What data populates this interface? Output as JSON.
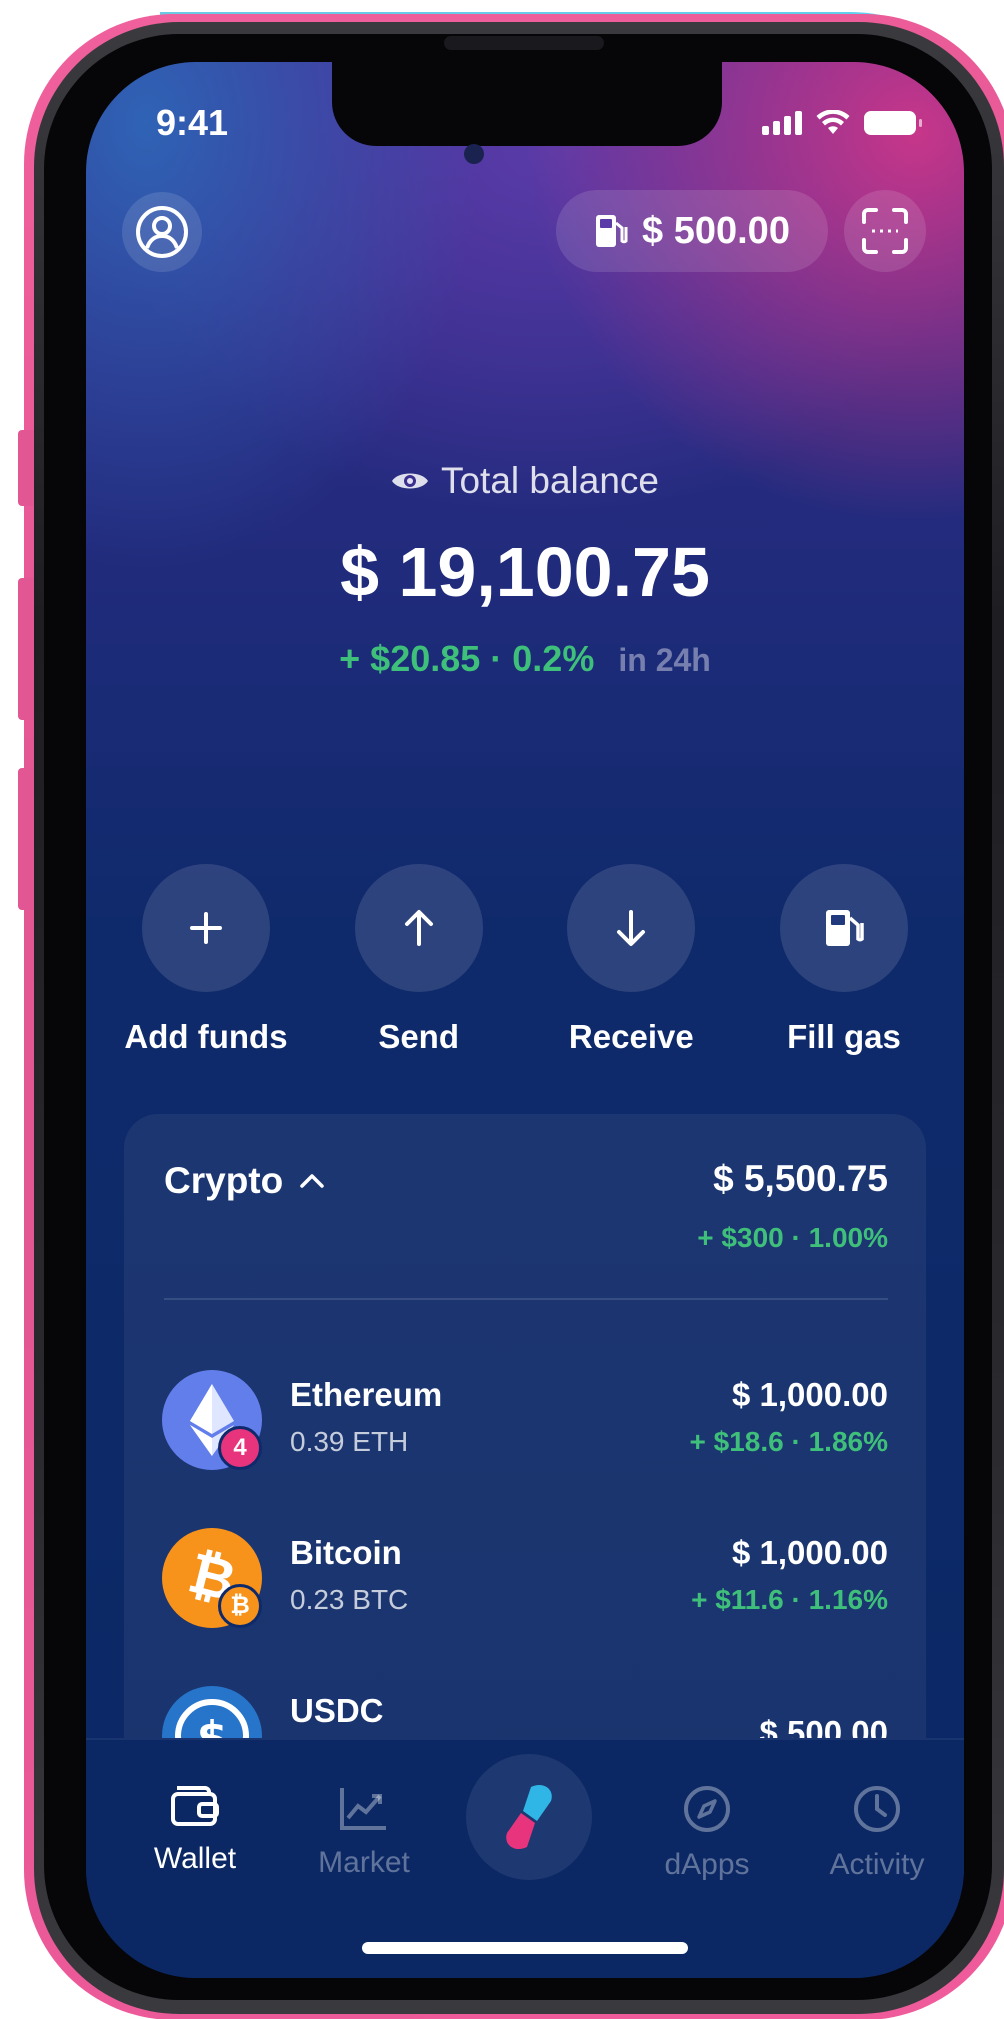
{
  "status_bar": {
    "time": "9:41"
  },
  "header": {
    "gas_balance": "$ 500.00"
  },
  "balance": {
    "label": "Total balance",
    "total": "$ 19,100.75",
    "change": "+ $20.85 · 0.2%",
    "period": "in 24h"
  },
  "actions": [
    {
      "label": "Add funds",
      "icon": "plus-icon"
    },
    {
      "label": "Send",
      "icon": "arrow-up-icon"
    },
    {
      "label": "Receive",
      "icon": "arrow-down-icon"
    },
    {
      "label": "Fill gas",
      "icon": "gas-pump-icon"
    }
  ],
  "crypto": {
    "title": "Crypto",
    "total": "$ 5,500.75",
    "change": "+ $300 · 1.00%",
    "assets": [
      {
        "name": "Ethereum",
        "amount": "0.39 ETH",
        "value": "$ 1,000.00",
        "change": "+ $18.6 · 1.86%",
        "badge": "4",
        "color": "#627eea"
      },
      {
        "name": "Bitcoin",
        "amount": "0.23 BTC",
        "value": "$ 1,000.00",
        "change": "+ $11.6 · 1.16%",
        "badge": "₿",
        "color": "#f7931a"
      },
      {
        "name": "USDC",
        "amount": "",
        "value": "$ 500.00",
        "change": "",
        "badge": "",
        "color": "#2775ca"
      }
    ]
  },
  "tabs": [
    {
      "label": "Wallet",
      "icon": "wallet-icon",
      "active": true
    },
    {
      "label": "Market",
      "icon": "chart-icon",
      "active": false
    },
    {
      "label": "dApps",
      "icon": "compass-icon",
      "active": false
    },
    {
      "label": "Activity",
      "icon": "clock-icon",
      "active": false
    }
  ],
  "colors": {
    "positive": "#3fc07a",
    "accent_pink": "#e8347d",
    "accent_cyan": "#2fb6e6"
  }
}
